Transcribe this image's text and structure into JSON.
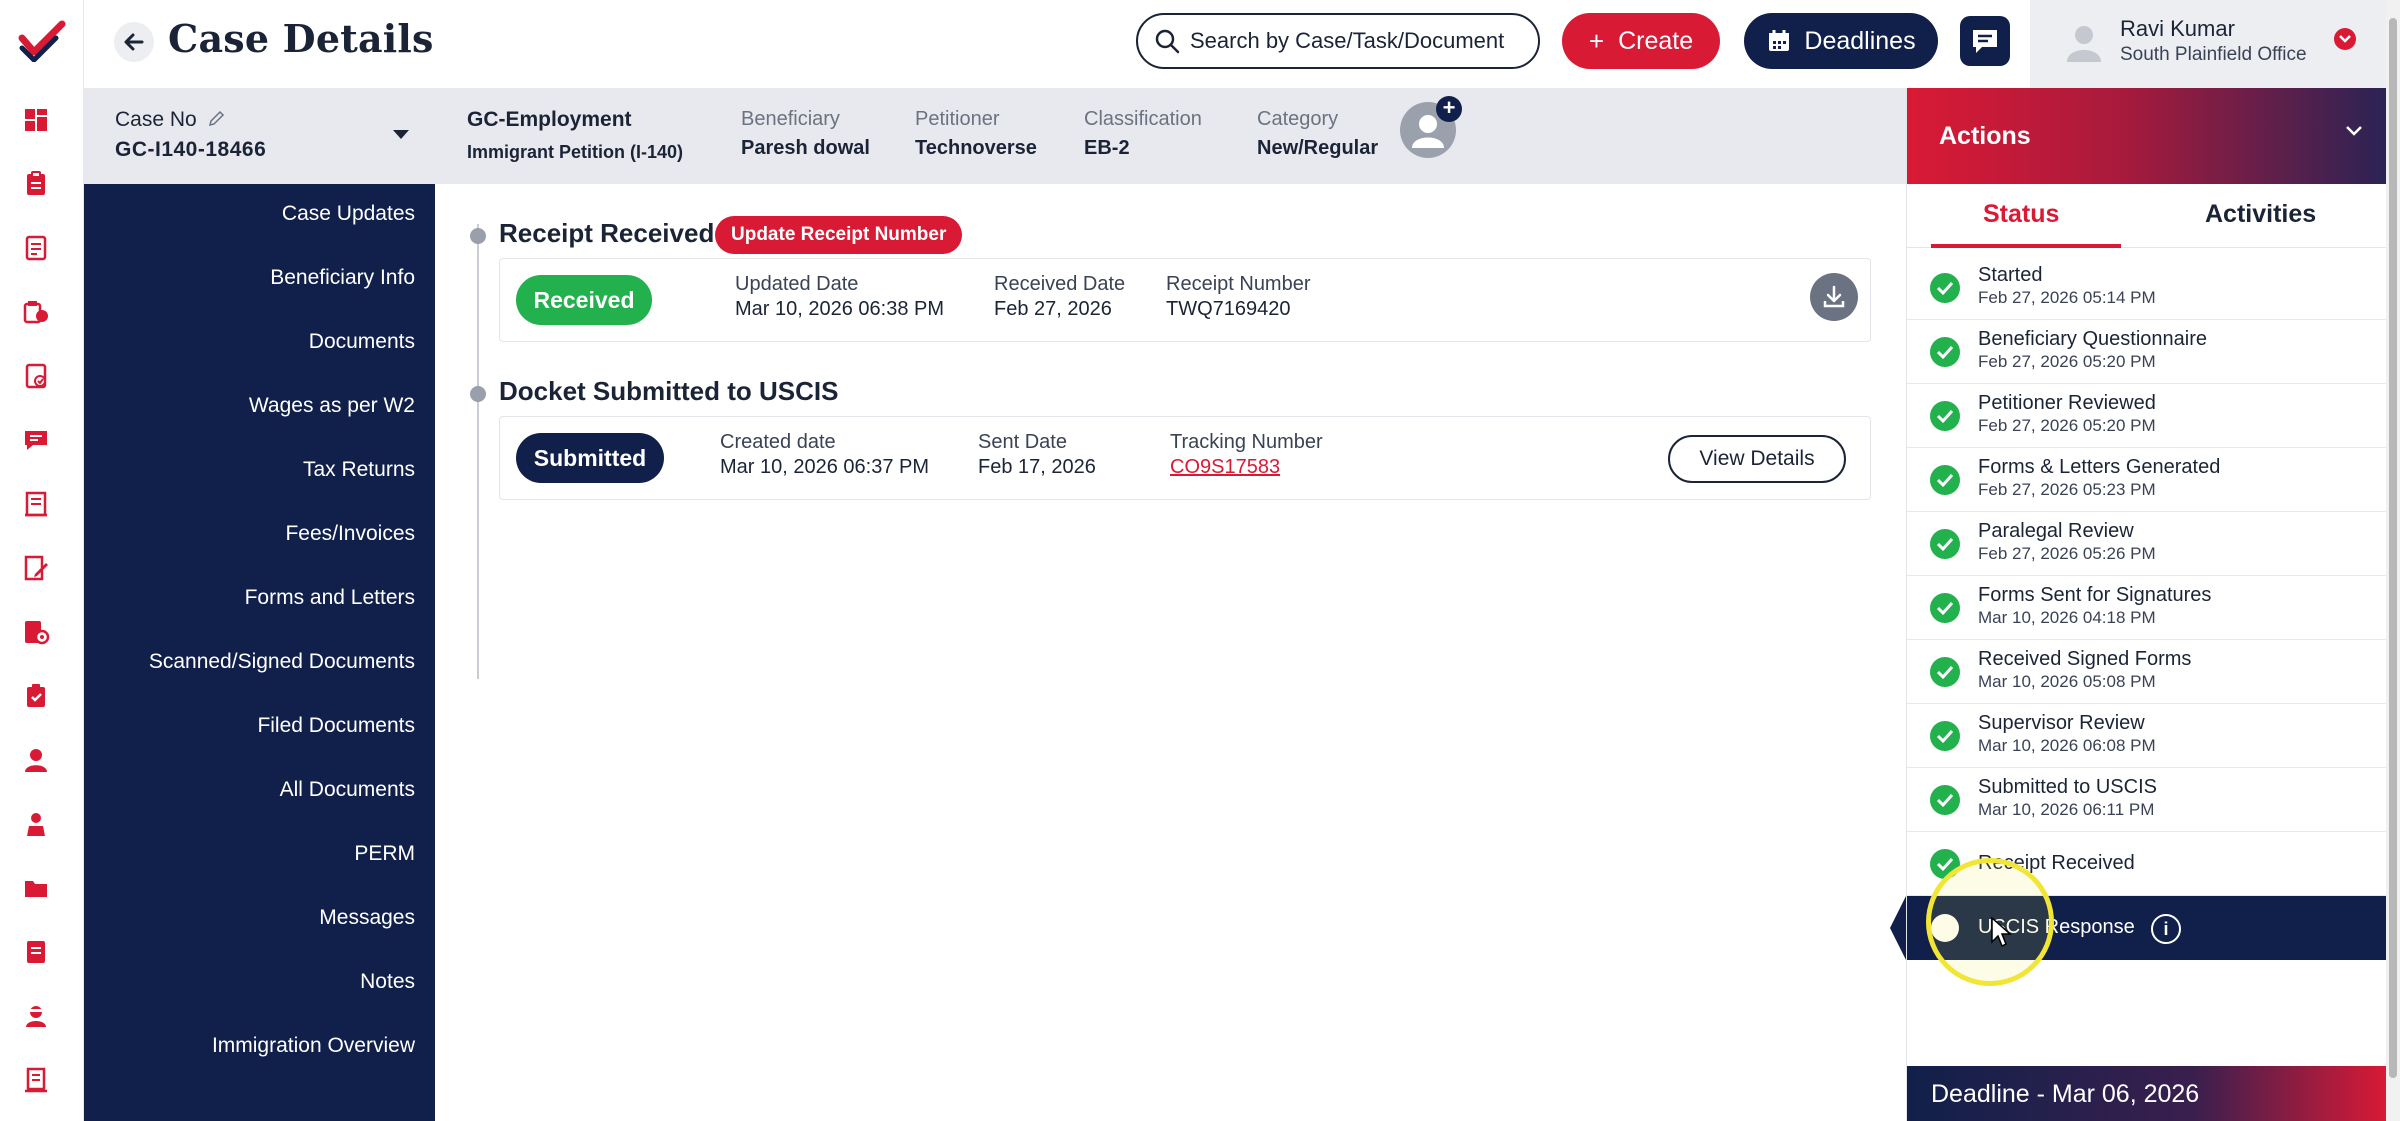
{
  "header": {
    "title": "Case Details",
    "search_placeholder": "Search by Case/Task/Document",
    "create_label": "Create",
    "deadlines_label": "Deadlines",
    "user_name": "Ravi Kumar",
    "user_office": "South Plainfield Office"
  },
  "info": {
    "case_no_label": "Case No",
    "case_no": "GC-I140-18466",
    "case_type": "GC-Employment",
    "case_subtype": "Immigrant Petition (I-140)",
    "fields": [
      {
        "label": "Beneficiary",
        "value": "Paresh dowal"
      },
      {
        "label": "Petitioner",
        "value": "Technoverse"
      },
      {
        "label": "Classification",
        "value": "EB-2"
      },
      {
        "label": "Category",
        "value": "New/Regular"
      }
    ]
  },
  "sidebar": {
    "items": [
      {
        "label": "Case Updates"
      },
      {
        "label": "Beneficiary Info"
      },
      {
        "label": "Documents"
      },
      {
        "label": "Wages as per W2"
      },
      {
        "label": "Tax Returns"
      },
      {
        "label": "Fees/Invoices"
      },
      {
        "label": "Forms and Letters"
      },
      {
        "label": "Scanned/Signed Documents"
      },
      {
        "label": "Filed Documents"
      },
      {
        "label": "All Documents"
      },
      {
        "label": "PERM"
      },
      {
        "label": "Messages"
      },
      {
        "label": "Notes"
      },
      {
        "label": "Immigration Overview"
      }
    ]
  },
  "timeline": {
    "receipt": {
      "title": "Receipt Received",
      "action": "Update Receipt Number",
      "status": "Received",
      "fields": [
        {
          "label": "Updated Date",
          "value": "Mar 10, 2026 06:38 PM"
        },
        {
          "label": "Received Date",
          "value": "Feb 27, 2026"
        },
        {
          "label": "Receipt Number",
          "value": "TWQ7169420"
        }
      ]
    },
    "docket": {
      "title": "Docket Submitted to USCIS",
      "status": "Submitted",
      "fields": [
        {
          "label": "Created date",
          "value": "Mar 10, 2026 06:37 PM"
        },
        {
          "label": "Sent Date",
          "value": "Feb 17, 2026"
        },
        {
          "label": "Tracking Number",
          "value": "CO9S17583"
        }
      ],
      "view_label": "View Details"
    }
  },
  "actions": {
    "title": "Actions",
    "tabs": [
      "Status",
      "Activities"
    ],
    "statuses": [
      {
        "name": "Started",
        "date": "Feb 27, 2026 05:14 PM"
      },
      {
        "name": "Beneficiary Questionnaire",
        "date": "Feb 27, 2026 05:20 PM"
      },
      {
        "name": "Petitioner Reviewed",
        "date": "Feb 27, 2026 05:20 PM"
      },
      {
        "name": "Forms & Letters Generated",
        "date": "Feb 27, 2026 05:23 PM"
      },
      {
        "name": "Paralegal Review",
        "date": "Feb 27, 2026 05:26 PM"
      },
      {
        "name": "Forms Sent for Signatures",
        "date": "Mar 10, 2026 04:18 PM"
      },
      {
        "name": "Received Signed Forms",
        "date": "Mar 10, 2026 05:08 PM"
      },
      {
        "name": "Supervisor Review",
        "date": "Mar 10, 2026 06:08 PM"
      },
      {
        "name": "Submitted to USCIS",
        "date": "Mar 10, 2026 06:11 PM"
      },
      {
        "name": "Receipt Received",
        "date": ""
      }
    ],
    "pending": {
      "name": "USCIS Response",
      "info": "i"
    },
    "deadline": "Deadline - Mar 06, 2026"
  },
  "colors": {
    "brand_red": "#d91a35",
    "navy": "#10204a",
    "success": "#22b14c"
  }
}
